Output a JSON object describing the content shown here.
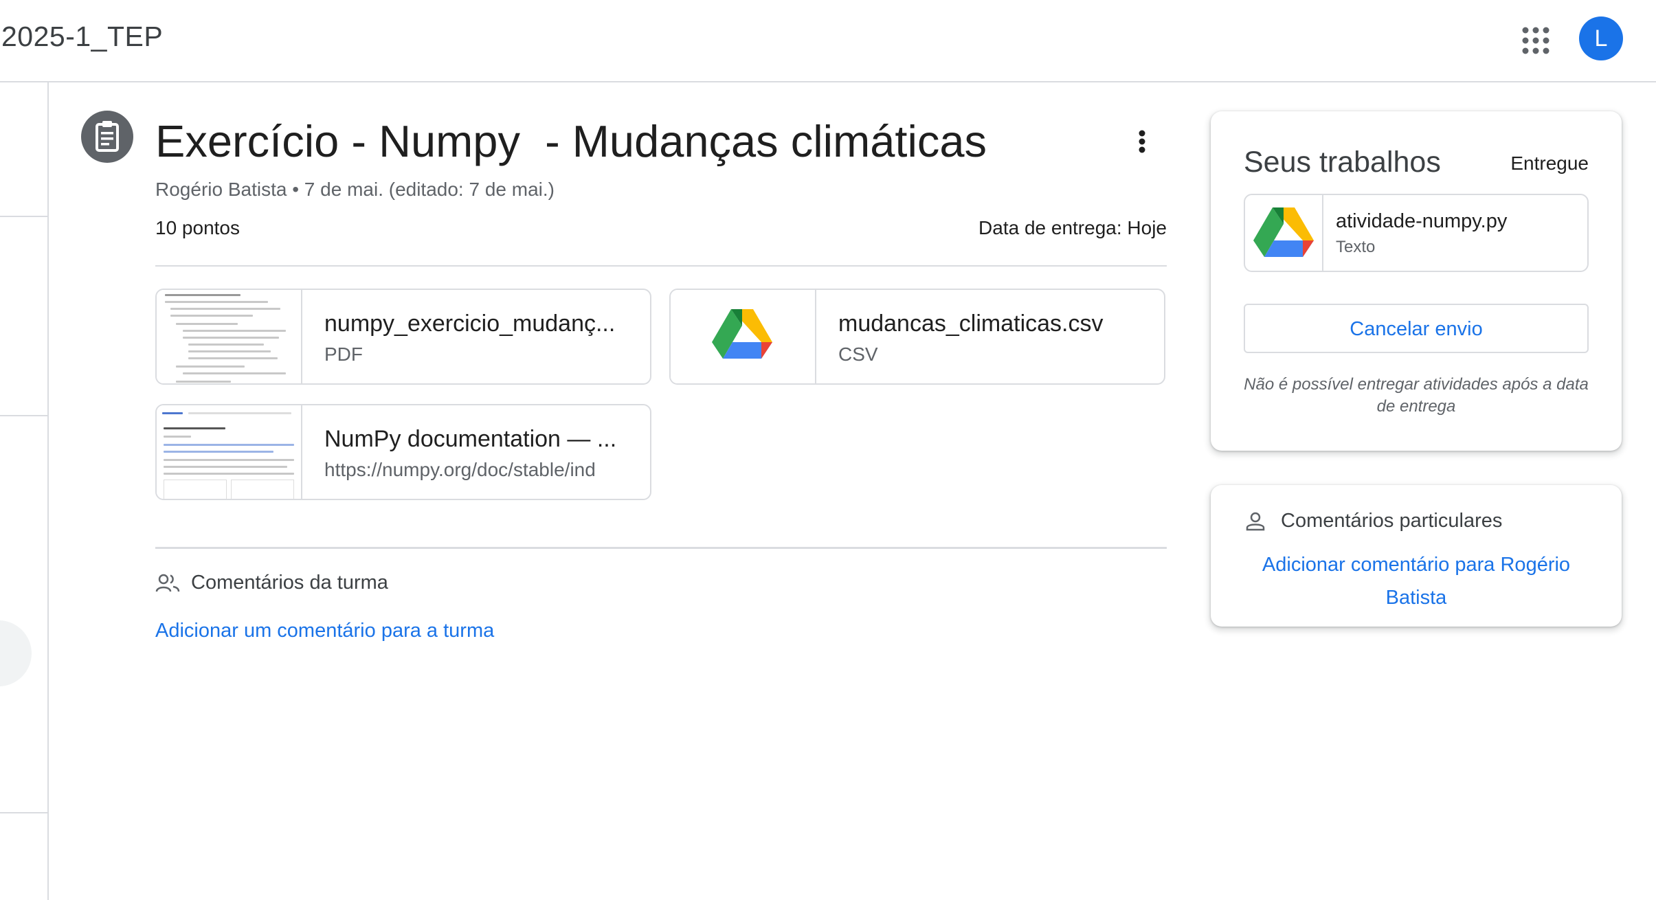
{
  "header": {
    "course_title": "2025-1_TEP",
    "avatar_letter": "L",
    "colors": {
      "accent": "#1a73e8",
      "avatar_bg": "#1a73e8",
      "icon_gray": "#5f6368"
    }
  },
  "assignment": {
    "title": "Exercício - Numpy  - Mudanças climáticas",
    "meta": "Rogério Batista • 7 de mai. (editado: 7 de mai.)",
    "points": "10 pontos",
    "due": "Data de entrega: Hoje",
    "icons": {
      "type": "assignment-icon",
      "more": "more-vert-icon"
    }
  },
  "attachments": [
    {
      "name": "numpy_exercicio_mudanç...",
      "type": "PDF",
      "thumb": "pdf-document-thumbnail"
    },
    {
      "name": "mudancas_climaticas.csv",
      "type": "CSV",
      "thumb": "google-drive-icon"
    },
    {
      "name": "NumPy documentation — ...",
      "type": "https://numpy.org/doc/stable/ind",
      "thumb": "webpage-thumbnail"
    }
  ],
  "class_comments": {
    "label": "Comentários da turma",
    "add_link": "Adicionar um comentário para a turma",
    "icon": "people-icon"
  },
  "your_work": {
    "title": "Seus trabalhos",
    "status": "Entregue",
    "file": {
      "name": "atividade-numpy.py",
      "type": "Texto",
      "icon": "google-drive-icon"
    },
    "cancel_label": "Cancelar envio",
    "late_note": "Não é possível entregar atividades após a data de entrega"
  },
  "private_comments": {
    "label": "Comentários particulares",
    "add_link": "Adicionar comentário para Rogério Batista",
    "icon": "person-icon"
  }
}
